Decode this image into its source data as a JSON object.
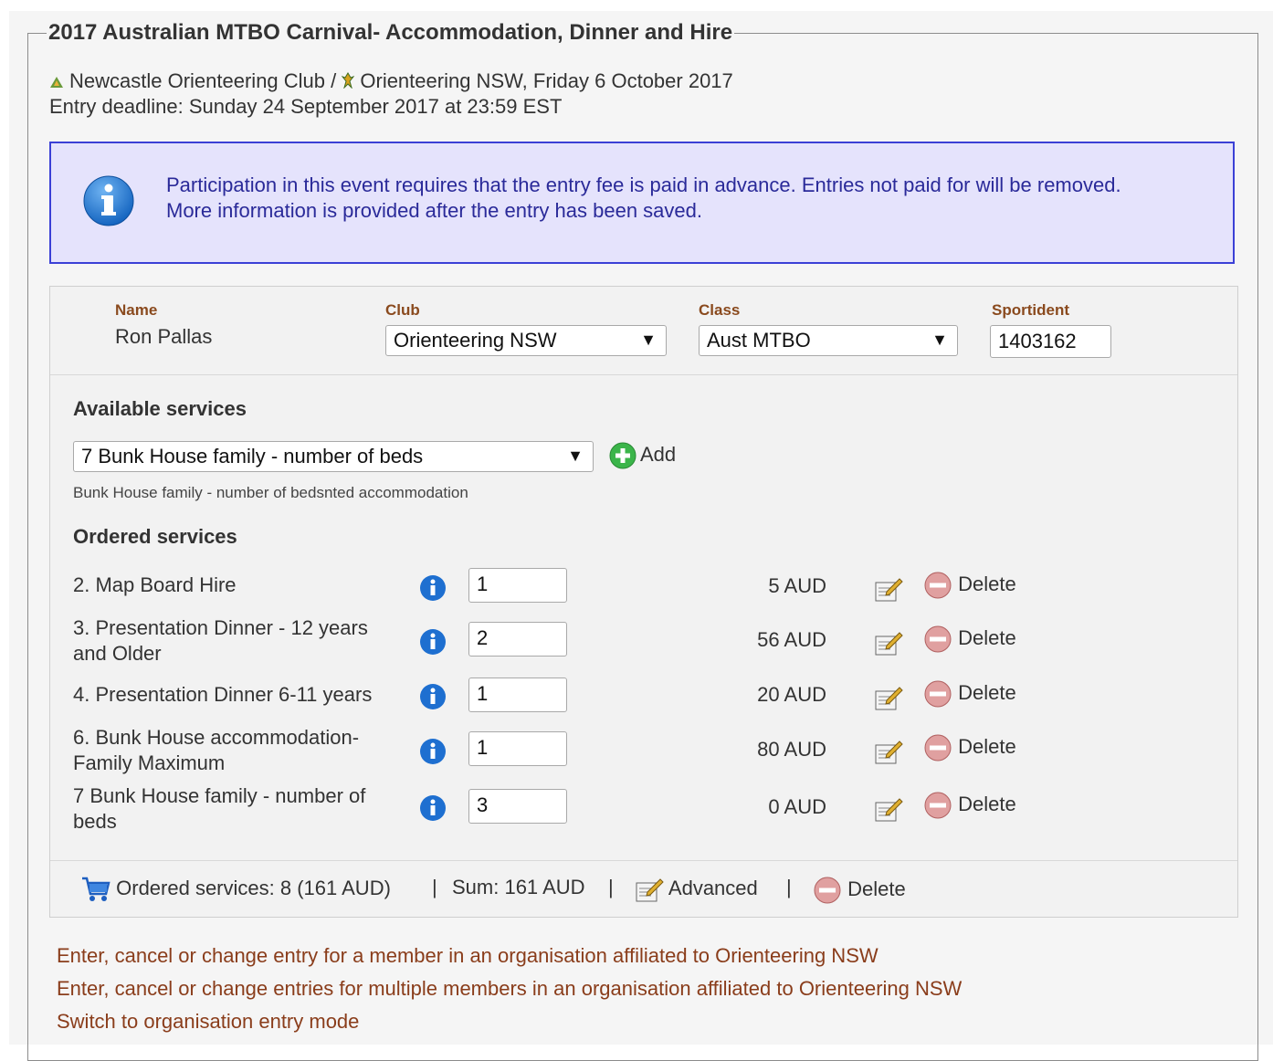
{
  "event": {
    "title": "2017 Australian MTBO Carnival- Accommodation, Dinner and Hire",
    "organiser_club": "Newcastle Orienteering Club",
    "separator": " / ",
    "organiser_assoc": "Orienteering NSW, Friday 6 October 2017",
    "deadline": "Entry deadline: Sunday 24 September 2017 at 23:59 EST"
  },
  "info": {
    "line1": "Participation in this event requires that the entry fee is paid in advance. Entries not paid for will be removed.",
    "line2": "More information is provided after the entry has been saved."
  },
  "entry": {
    "name_label": "Name",
    "name_value": "Ron Pallas",
    "club_label": "Club",
    "club_value": "Orienteering NSW",
    "class_label": "Class",
    "class_value": "Aust MTBO",
    "si_label": "Sportident",
    "si_value": "1403162"
  },
  "services": {
    "available_title": "Available services",
    "selected_service": "7 Bunk House family - number of beds",
    "add_label": "Add",
    "hint": "Bunk House family - number of bedsnted accommodation",
    "ordered_title": "Ordered services",
    "delete_label": "Delete",
    "ordered": [
      {
        "name": "2. Map Board Hire",
        "qty": "1",
        "price": "5 AUD"
      },
      {
        "name": "3. Presentation Dinner - 12 years and Older",
        "qty": "2",
        "price": "56 AUD"
      },
      {
        "name": "4. Presentation Dinner 6-11 years",
        "qty": "1",
        "price": "20 AUD"
      },
      {
        "name": "6. Bunk House accommodation- Family Maximum",
        "qty": "1",
        "price": "80 AUD"
      },
      {
        "name": "7 Bunk House family - number of beds",
        "qty": "3",
        "price": "0 AUD"
      }
    ]
  },
  "footer": {
    "ordered_summary": "Ordered services: 8 (161 AUD)",
    "sep": "|",
    "sum": "Sum: 161 AUD",
    "advanced": "Advanced",
    "delete": "Delete"
  },
  "links": [
    "Enter, cancel or change entry for a member in an organisation affiliated to Orienteering NSW",
    "Enter, cancel or change entries for multiple members in an organisation affiliated to Orienteering NSW",
    "Switch to organisation entry mode"
  ],
  "colors": {
    "info_bg": "#e5e3fc",
    "info_border": "#3b40d6",
    "label_brown": "#8a4a1e",
    "link_brown": "#8a3d1b"
  }
}
